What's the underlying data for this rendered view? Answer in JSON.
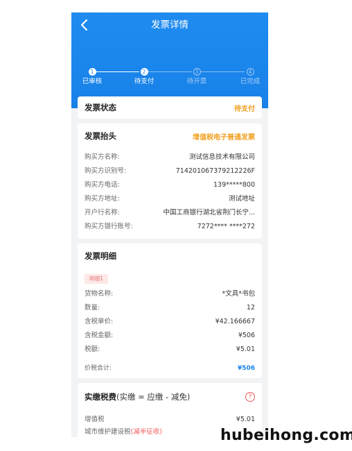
{
  "header": {
    "title": "发票详情"
  },
  "steps": [
    {
      "num": "1",
      "label": "已审核",
      "state": "done"
    },
    {
      "num": "2",
      "label": "待支付",
      "state": "done"
    },
    {
      "num": "3",
      "label": "待开票",
      "state": "todo"
    },
    {
      "num": "4",
      "label": "已完成",
      "state": "todo"
    }
  ],
  "status_card": {
    "title": "发票状态",
    "value": "待支付"
  },
  "invoice_header": {
    "title": "发票抬头",
    "type": "增值税电子普通发票",
    "rows": [
      {
        "key": "购买方名称:",
        "value": "测试信息技术有限公司"
      },
      {
        "key": "购买方识别号:",
        "value": "714201067379212226F"
      },
      {
        "key": "购买方电话:",
        "value": "139*****800"
      },
      {
        "key": "购买方地址:",
        "value": "测试地址"
      },
      {
        "key": "开户行名称:",
        "value": "中国工商银行湖北省荆门长宁..."
      },
      {
        "key": "购买方银行账号:",
        "value": "7272**** ****272"
      }
    ]
  },
  "invoice_detail": {
    "title": "发票明细",
    "tag": "明细1",
    "rows": [
      {
        "key": "货物名称:",
        "value": "*文具*书包"
      },
      {
        "key": "数量:",
        "value": "12"
      },
      {
        "key": "含税单价:",
        "value": "¥42.166667"
      },
      {
        "key": "含税金额:",
        "value": "¥506"
      },
      {
        "key": "税额:",
        "value": "¥5.01"
      }
    ],
    "total_key": "价税合计:",
    "total_value": "¥506"
  },
  "tax_card": {
    "title": "实缴税费",
    "subtitle": "(实缴 = 应缴 - 减免)",
    "help": "?",
    "rows": [
      {
        "key": "增值税",
        "value": "¥5.01"
      }
    ],
    "partial_key": "城市维护建设税",
    "partial_note": "(减半征收)"
  },
  "watermark": "hubeihong.com"
}
